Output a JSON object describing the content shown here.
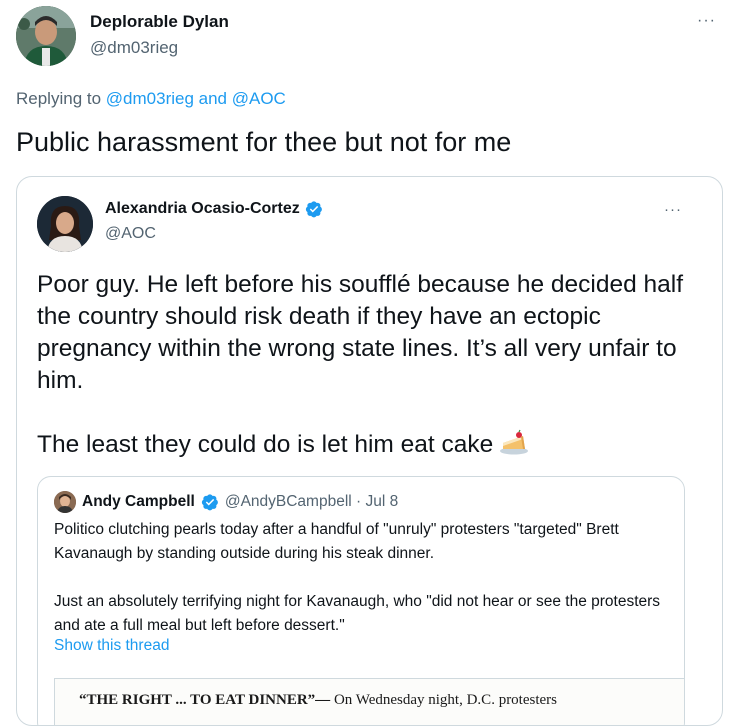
{
  "tweet": {
    "author_name": "Deplorable Dylan",
    "author_handle": "@dm03rieg",
    "more_label": "···",
    "replying_prefix": "Replying to ",
    "replying_user1": "@dm03rieg",
    "replying_and": " and ",
    "replying_user2": "@AOC",
    "text": "Public harassment for thee but not for me"
  },
  "quote": {
    "author_name": "Alexandria Ocasio-Cortez",
    "author_handle": "@AOC",
    "more_label": "···",
    "paragraph1": "Poor guy. He left before his soufflé because he decided half the country should risk death if they have an ectopic pregnancy within the wrong state lines. It’s all very unfair to him.",
    "paragraph2": "The least they could do is let him eat cake",
    "emoji": "cake-emoji"
  },
  "inner_quote": {
    "author_name": "Andy Campbell",
    "author_handle_date": "@AndyBCampbell · Jul 8",
    "paragraph1": "Politico clutching pearls today after a handful of \"unruly\" protesters \"targeted\" Brett Kavanaugh by standing outside during his steak dinner.",
    "paragraph2": "Just an absolutely terrifying night for Kavanaugh, who \"did not hear or see the protesters and ate a full meal but left before dessert.\"",
    "show_thread": "Show this thread",
    "media_headline": "“THE RIGHT ... TO EAT DINNER”—",
    "media_text": " On Wednesday night, D.C. protesters"
  },
  "colors": {
    "link": "#1d9bf0",
    "secondary": "#536471",
    "verified": "#1d9bf0",
    "border": "#cfd9de"
  }
}
